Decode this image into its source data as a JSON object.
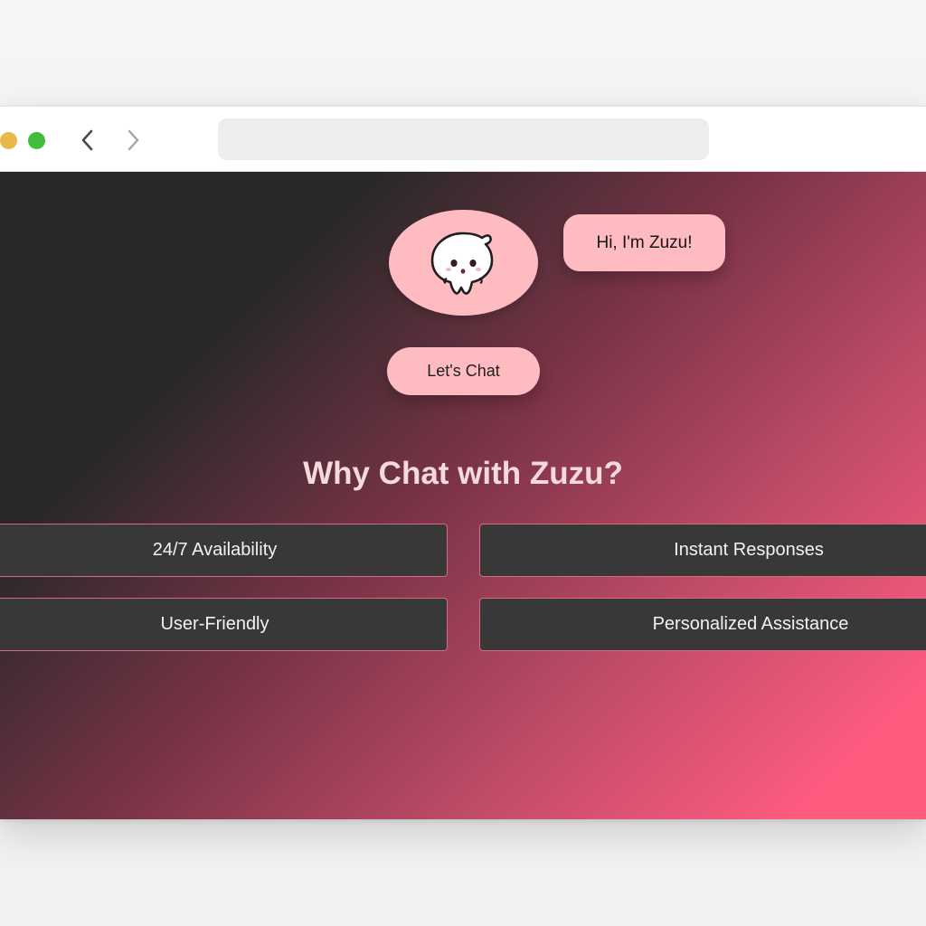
{
  "browser": {
    "window_controls": [
      "yellow-light",
      "green-light"
    ],
    "nav": {
      "back_icon": "chevron-left-icon",
      "forward_icon": "chevron-right-icon"
    },
    "address_bar": {
      "value": "",
      "placeholder": ""
    }
  },
  "hero": {
    "mascot_icon": "ghost-icon",
    "speech_bubble": "Hi, I'm Zuzu!",
    "cta_label": "Let's Chat"
  },
  "features": {
    "heading": "Why Chat with Zuzu?",
    "items": [
      {
        "label": "24/7 Availability"
      },
      {
        "label": "Instant Responses"
      },
      {
        "label": "User-Friendly"
      },
      {
        "label": "Personalized Assistance"
      }
    ]
  },
  "colors": {
    "accent_pink": "#ffbcc0",
    "card_bg": "#383838",
    "card_border": "#d56b83",
    "gradient_start": "#282828",
    "gradient_end": "#ff5b7f",
    "heading_text": "#f4d9df"
  }
}
